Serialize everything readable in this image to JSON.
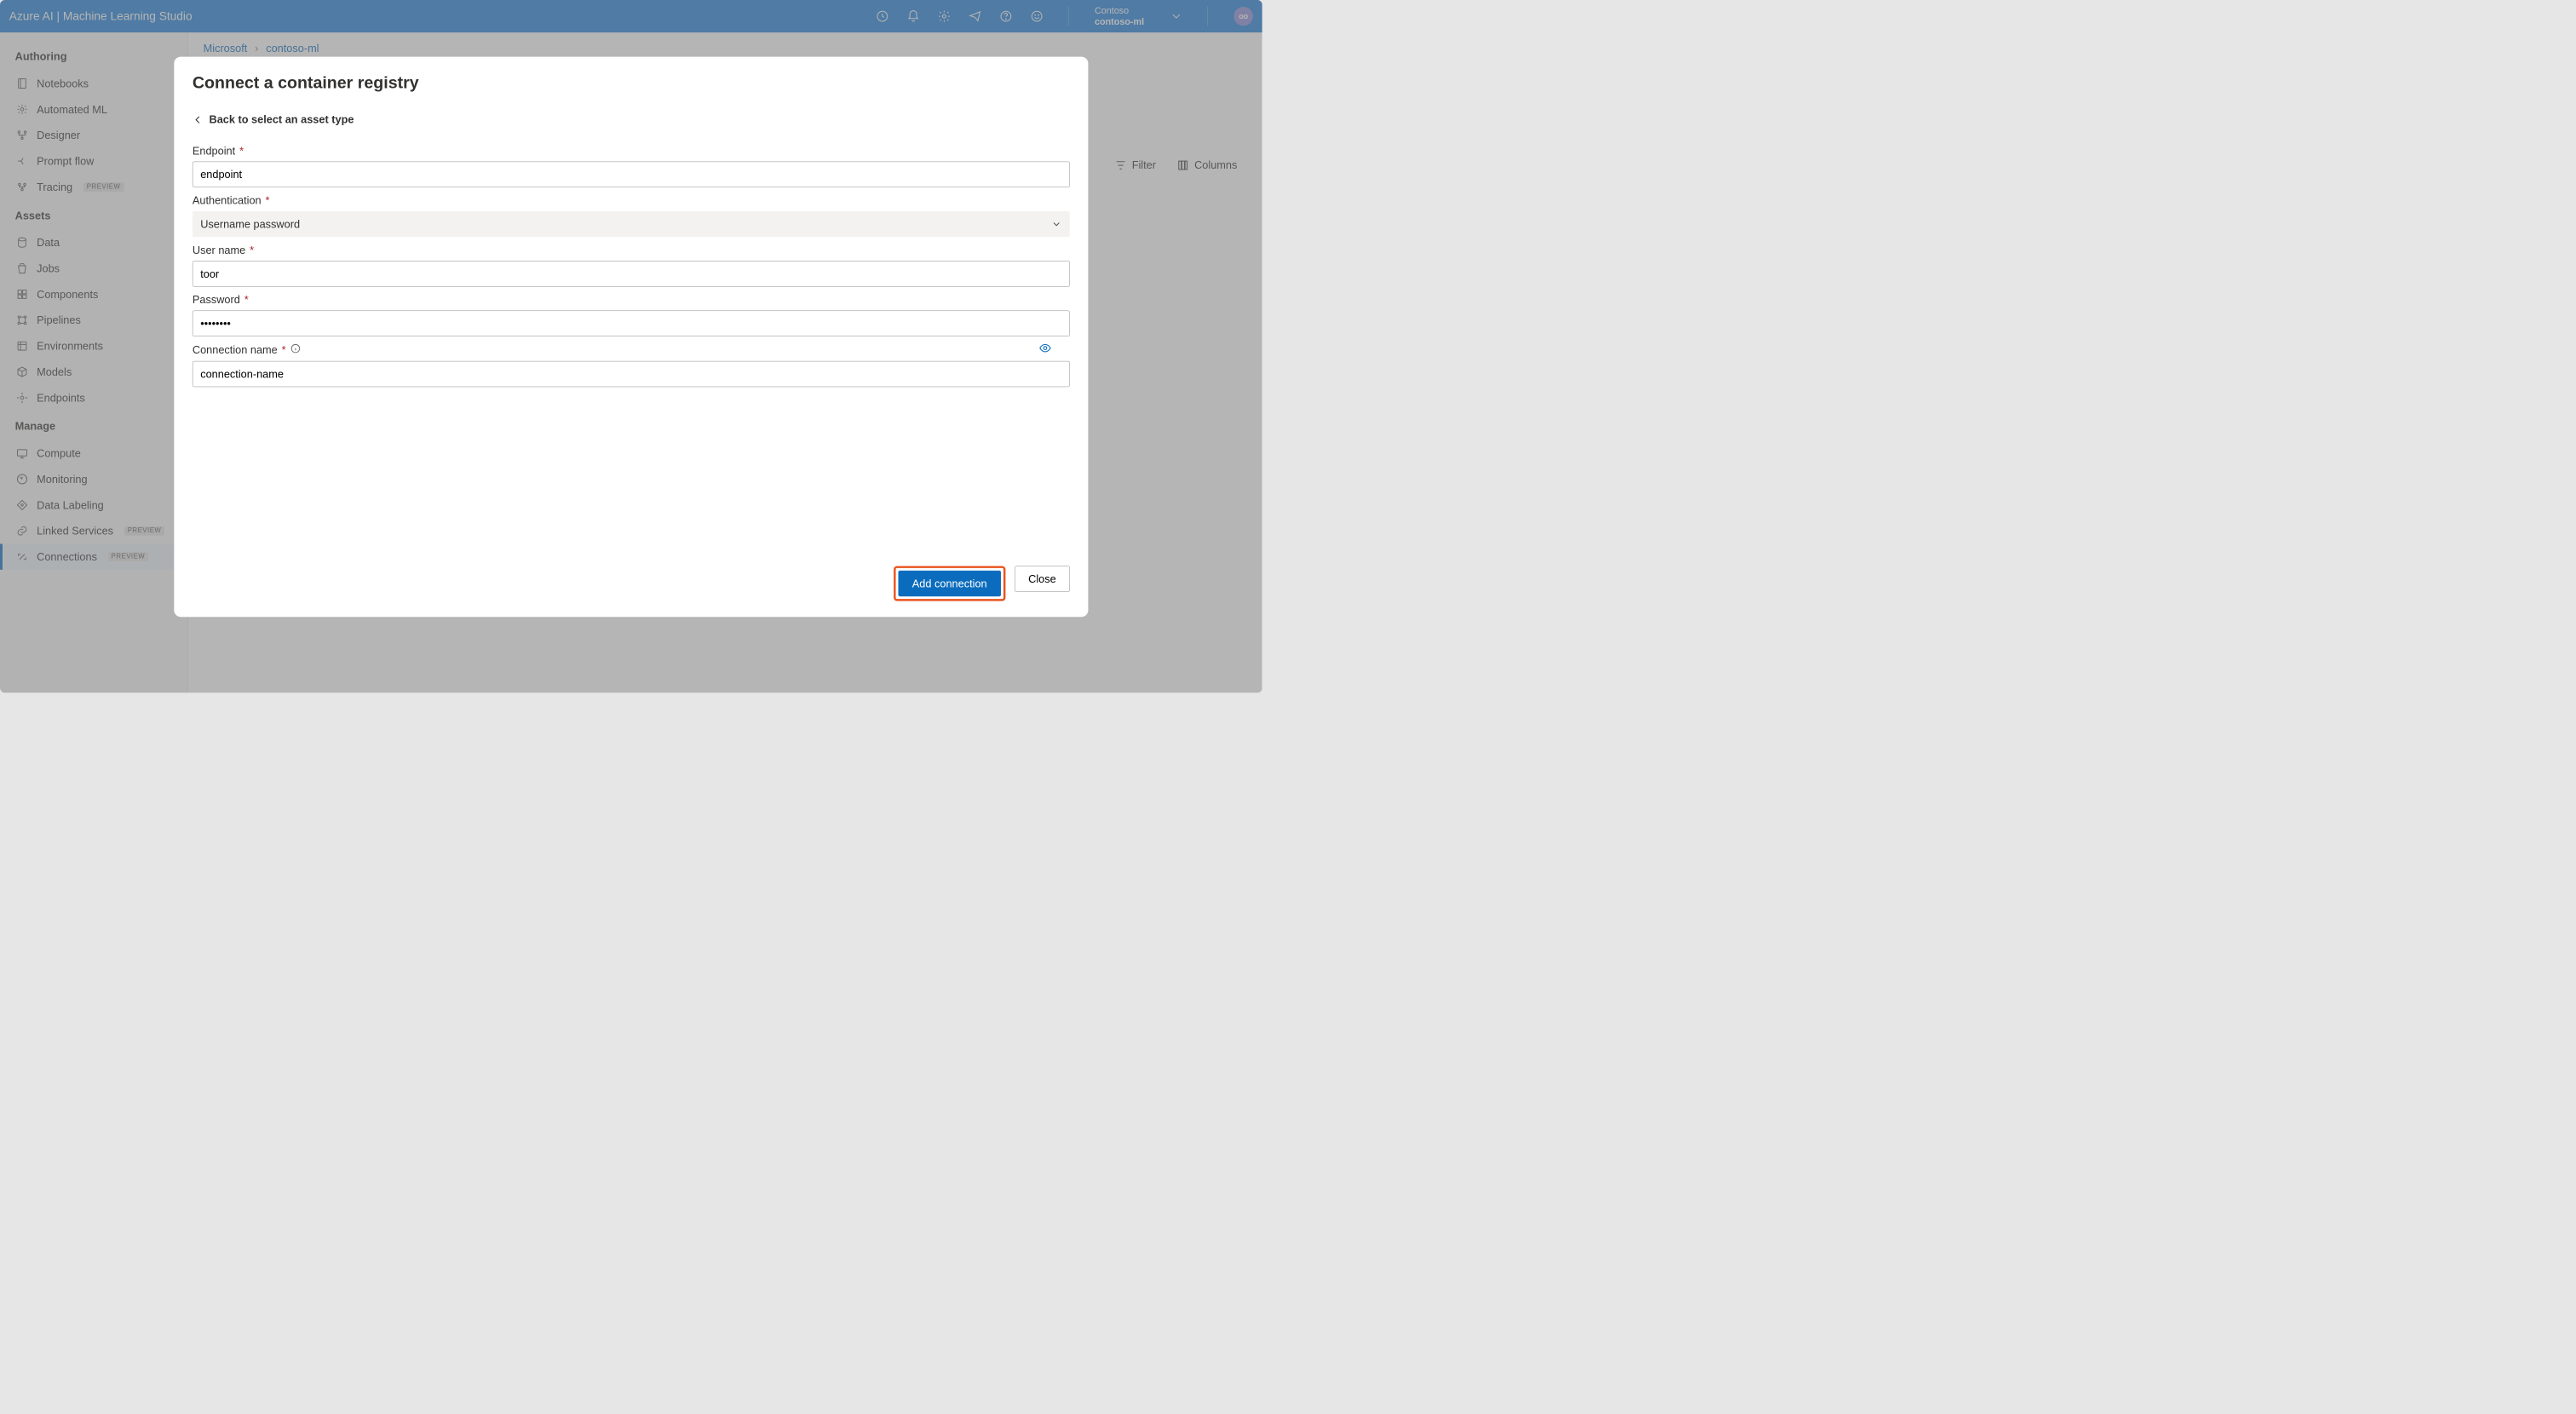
{
  "header": {
    "title": "Azure AI | Machine Learning Studio",
    "workspace_org": "Contoso",
    "workspace_name": "contoso-ml",
    "avatar_initials": "oo"
  },
  "sidebar": {
    "sections": [
      {
        "title": "Authoring",
        "items": [
          {
            "label": "Notebooks",
            "icon": "notebook-icon"
          },
          {
            "label": "Automated ML",
            "icon": "automl-icon"
          },
          {
            "label": "Designer",
            "icon": "designer-icon"
          },
          {
            "label": "Prompt flow",
            "icon": "promptflow-icon"
          },
          {
            "label": "Tracing",
            "icon": "tracing-icon",
            "badge": "PREVIEW"
          }
        ]
      },
      {
        "title": "Assets",
        "items": [
          {
            "label": "Data",
            "icon": "data-icon"
          },
          {
            "label": "Jobs",
            "icon": "jobs-icon"
          },
          {
            "label": "Components",
            "icon": "components-icon"
          },
          {
            "label": "Pipelines",
            "icon": "pipelines-icon"
          },
          {
            "label": "Environments",
            "icon": "environments-icon"
          },
          {
            "label": "Models",
            "icon": "models-icon"
          },
          {
            "label": "Endpoints",
            "icon": "endpoints-icon"
          }
        ]
      },
      {
        "title": "Manage",
        "items": [
          {
            "label": "Compute",
            "icon": "compute-icon"
          },
          {
            "label": "Monitoring",
            "icon": "monitoring-icon"
          },
          {
            "label": "Data Labeling",
            "icon": "datalabeling-icon"
          },
          {
            "label": "Linked Services",
            "icon": "linkedservices-icon",
            "badge": "PREVIEW"
          },
          {
            "label": "Connections",
            "icon": "connections-icon",
            "badge": "PREVIEW",
            "active": true
          }
        ]
      }
    ]
  },
  "breadcrumb": {
    "root": "Microsoft",
    "leaf": "contoso-ml"
  },
  "toolbar": {
    "filter": "Filter",
    "columns": "Columns"
  },
  "modal": {
    "title": "Connect a container registry",
    "back_label": "Back to select an asset type",
    "fields": {
      "endpoint": {
        "label": "Endpoint",
        "value": "endpoint"
      },
      "auth": {
        "label": "Authentication",
        "value": "Username password"
      },
      "username": {
        "label": "User name",
        "value": "toor"
      },
      "password": {
        "label": "Password",
        "value": "••••••••"
      },
      "connection": {
        "label": "Connection name",
        "value": "connection-name"
      }
    },
    "buttons": {
      "primary": "Add connection",
      "secondary": "Close"
    }
  }
}
